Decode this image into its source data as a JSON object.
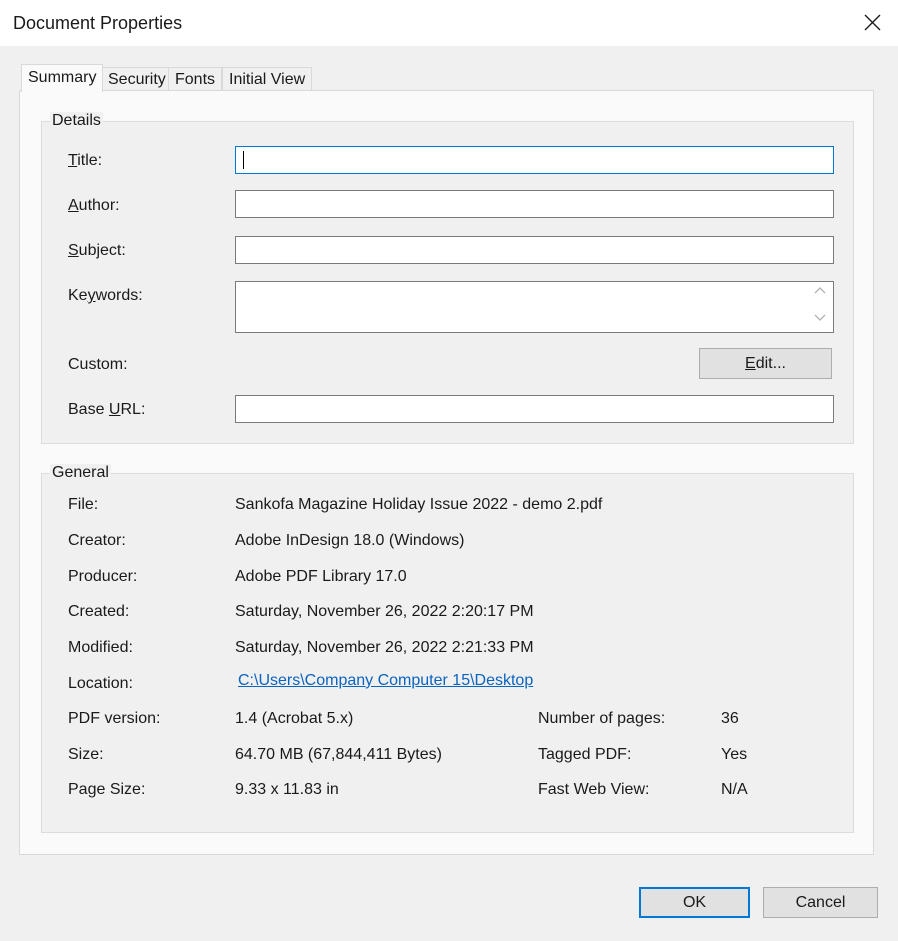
{
  "window": {
    "title": "Document Properties"
  },
  "tabs": [
    {
      "label": "Summary",
      "active": true
    },
    {
      "label": "Security"
    },
    {
      "label": "Fonts"
    },
    {
      "label": "Initial View"
    }
  ],
  "details": {
    "legend": "Details",
    "title": {
      "label_pre": "",
      "label_ul": "T",
      "label_post": "itle:",
      "value": ""
    },
    "author": {
      "label_pre": "",
      "label_ul": "A",
      "label_post": "uthor:",
      "value": ""
    },
    "subject": {
      "label_pre": "",
      "label_ul": "S",
      "label_post": "ubject:",
      "value": ""
    },
    "keywords": {
      "label_pre": "Ke",
      "label_ul": "y",
      "label_post": "words:",
      "value": ""
    },
    "custom": {
      "label": "Custom:",
      "edit_pre": "",
      "edit_ul": "E",
      "edit_post": "dit..."
    },
    "base_url": {
      "label_pre": "Base ",
      "label_ul": "U",
      "label_post": "RL:",
      "value": ""
    }
  },
  "general": {
    "legend": "General",
    "file": {
      "label": "File:",
      "value": "Sankofa Magazine Holiday Issue 2022 - demo 2.pdf"
    },
    "creator": {
      "label": "Creator:",
      "value": "Adobe InDesign 18.0 (Windows)"
    },
    "producer": {
      "label": "Producer:",
      "value": "Adobe PDF Library 17.0"
    },
    "created": {
      "label": "Created:",
      "value": "Saturday, November 26, 2022 2:20:17 PM"
    },
    "modified": {
      "label": "Modified:",
      "value": "Saturday, November 26, 2022 2:21:33 PM"
    },
    "location": {
      "label": "Location:",
      "value": "C:\\Users\\Company Computer 15\\Desktop"
    },
    "pdf_version": {
      "label": "PDF version:",
      "value": "1.4 (Acrobat 5.x)"
    },
    "size": {
      "label": "Size:",
      "value": "64.70 MB (67,844,411 Bytes)"
    },
    "page_size": {
      "label": "Page Size:",
      "value": "9.33 x 11.83 in"
    },
    "num_pages": {
      "label": "Number of pages:",
      "value": "36"
    },
    "tagged_pdf": {
      "label": "Tagged PDF:",
      "value": "Yes"
    },
    "fast_web_view": {
      "label": "Fast Web View:",
      "value": "N/A"
    }
  },
  "buttons": {
    "ok": "OK",
    "cancel": "Cancel"
  },
  "icons": {
    "close": "close-icon",
    "scroll_up": "chevron-up-icon",
    "scroll_down": "chevron-down-icon"
  },
  "colors": {
    "link": "#0b64c0",
    "focus_border": "#0078d7"
  }
}
